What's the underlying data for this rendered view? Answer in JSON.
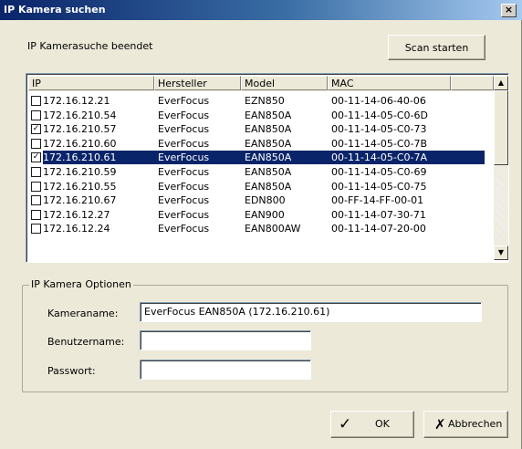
{
  "window": {
    "title": "IP Kamera suchen",
    "close_glyph": "×"
  },
  "status_text": "IP Kamerasuche beendet",
  "scan_button": "Scan starten",
  "columns": [
    "IP",
    "Hersteller",
    "Model",
    "MAC"
  ],
  "rows": [
    {
      "checked": false,
      "ip": "172.16.12.21",
      "vendor": "EverFocus",
      "model": "EZN850",
      "mac": "00-11-14-06-40-06"
    },
    {
      "checked": false,
      "ip": "172.16.210.54",
      "vendor": "EverFocus",
      "model": "EAN850A",
      "mac": "00-11-14-05-C0-6D"
    },
    {
      "checked": true,
      "ip": "172.16.210.57",
      "vendor": "EverFocus",
      "model": "EAN850A",
      "mac": "00-11-14-05-C0-73"
    },
    {
      "checked": false,
      "ip": "172.16.210.60",
      "vendor": "EverFocus",
      "model": "EAN850A",
      "mac": "00-11-14-05-C0-7B"
    },
    {
      "checked": true,
      "selected": true,
      "ip": "172.16.210.61",
      "vendor": "EverFocus",
      "model": "EAN850A",
      "mac": "00-11-14-05-C0-7A"
    },
    {
      "checked": false,
      "ip": "172.16.210.59",
      "vendor": "EverFocus",
      "model": "EAN850A",
      "mac": "00-11-14-05-C0-69"
    },
    {
      "checked": false,
      "ip": "172.16.210.55",
      "vendor": "EverFocus",
      "model": "EAN850A",
      "mac": "00-11-14-05-C0-75"
    },
    {
      "checked": false,
      "ip": "172.16.210.67",
      "vendor": "EverFocus",
      "model": "EDN800",
      "mac": "00-FF-14-FF-00-01"
    },
    {
      "checked": false,
      "ip": "172.16.12.27",
      "vendor": "EverFocus",
      "model": "EAN900",
      "mac": "00-11-14-07-30-71"
    },
    {
      "checked": false,
      "ip": "172.16.12.24",
      "vendor": "EverFocus",
      "model": "EAN800AW",
      "mac": "00-11-14-07-20-00"
    }
  ],
  "options": {
    "group_label": "IP Kamera Optionen",
    "camera_name_label": "Kameraname:",
    "camera_name_value": "EverFocus EAN850A (172.16.210.61)",
    "username_label": "Benutzername:",
    "username_value": "",
    "password_label": "Passwort:",
    "password_value": ""
  },
  "ok_button": {
    "label": "OK",
    "icon": "check-icon",
    "glyph": "✓"
  },
  "cancel_button": {
    "label": "Abbrechen",
    "icon": "x-icon",
    "glyph": "✗"
  },
  "scroll_up_glyph": "▲",
  "scroll_down_glyph": "▼",
  "check_glyph": "✓",
  "colors": {
    "title_start": "#0a246a",
    "title_end": "#a6caf0",
    "selection": "#0a246a",
    "face": "#ece9d8"
  }
}
